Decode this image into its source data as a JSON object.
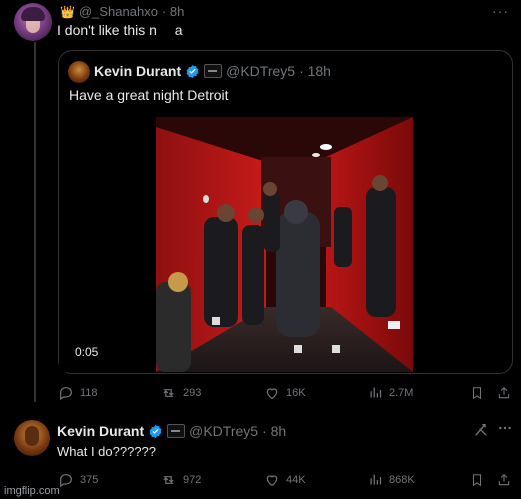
{
  "reply_tweet": {
    "crown": "👑",
    "handle": "@_Shanahxo",
    "time": "· 8h",
    "text": "I don't like this n",
    "text_tail": "a",
    "more": "···"
  },
  "quoted_tweet": {
    "name": "Kevin Durant",
    "handle": "@KDTrey5",
    "time": "· 18h",
    "text": "Have a great night Detroit",
    "video_time": "0:05"
  },
  "actions_1": {
    "replies": "118",
    "retweets": "293",
    "likes": "16K",
    "views": "2.7M"
  },
  "kd_tweet": {
    "name": "Kevin Durant",
    "handle": "@KDTrey5",
    "time": "· 8h",
    "text": "What I do??????"
  },
  "actions_2": {
    "replies": "375",
    "retweets": "972",
    "likes": "44K",
    "views": "868K"
  },
  "watermark": "imgflip.com",
  "colors": {
    "background": "#000000",
    "text": "#e7e9ea",
    "muted": "#71767b",
    "verified": "#1d9bf0",
    "border": "#2f3336"
  }
}
